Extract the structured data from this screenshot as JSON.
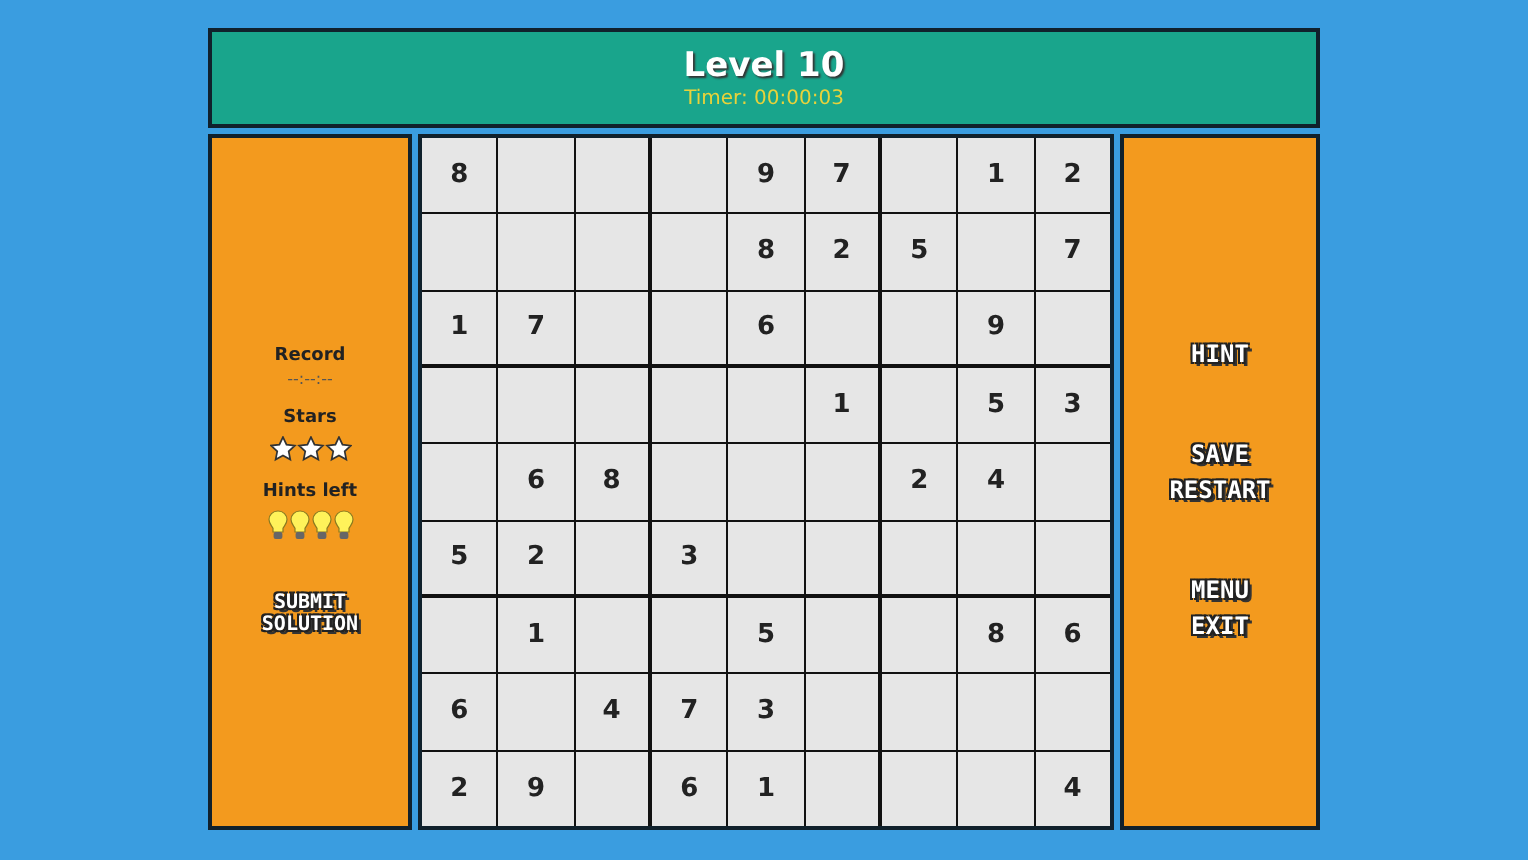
{
  "header": {
    "title": "Level 10",
    "timer": "Timer: 00:00:03"
  },
  "left_panel": {
    "record_label": "Record",
    "record_value": "--:--:--",
    "stars_label": "Stars",
    "stars": 3,
    "hints_label": "Hints left",
    "hint_bulbs": [
      {
        "used": false
      },
      {
        "used": false
      },
      {
        "used": false
      },
      {
        "used": false
      }
    ],
    "buttons": [
      "SUBMIT SOLUTION"
    ]
  },
  "grid": {
    "rows": [
      [
        "8",
        null,
        null,
        null,
        "9",
        "7",
        null,
        "1",
        "2"
      ],
      [
        null,
        null,
        null,
        null,
        "8",
        "2",
        "5",
        null,
        "7"
      ],
      [
        "1",
        "7",
        null,
        null,
        "6",
        null,
        null,
        "9",
        null
      ],
      [
        null,
        null,
        null,
        null,
        null,
        "1",
        null,
        "5",
        "3"
      ],
      [
        null,
        "6",
        "8",
        null,
        null,
        null,
        "2",
        "4",
        null
      ],
      [
        "5",
        "2",
        null,
        "3",
        null,
        null,
        null,
        null,
        null
      ],
      [
        null,
        "1",
        null,
        null,
        "5",
        null,
        null,
        "8",
        "6"
      ],
      [
        "6",
        null,
        "4",
        "7",
        "3",
        null,
        null,
        null,
        null
      ],
      [
        "2",
        "9",
        null,
        "6",
        "1",
        null,
        null,
        null,
        "4"
      ]
    ]
  },
  "right_panel": {
    "button_groups": [
      [
        "HINT"
      ],
      [
        "SAVE",
        "RESTART"
      ],
      [
        "MENU",
        "EXIT"
      ]
    ]
  }
}
